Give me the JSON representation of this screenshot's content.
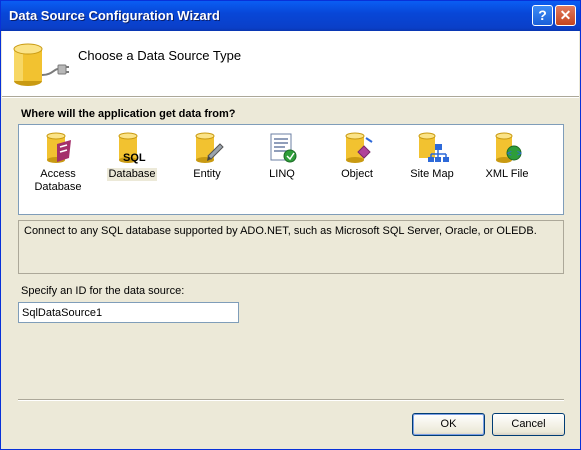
{
  "window": {
    "title": "Data Source Configuration Wizard",
    "help_button": "?",
    "close_button": "✕"
  },
  "header": {
    "title": "Choose a Data Source Type"
  },
  "question": "Where will the application get data from?",
  "data_source_types": [
    {
      "label": "Access\nDatabase",
      "icon": "access-database-icon",
      "selected": false
    },
    {
      "label": "Database",
      "icon": "sql-database-icon",
      "selected": true
    },
    {
      "label": "Entity",
      "icon": "entity-icon",
      "selected": false
    },
    {
      "label": "LINQ",
      "icon": "linq-icon",
      "selected": false
    },
    {
      "label": "Object",
      "icon": "object-icon",
      "selected": false
    },
    {
      "label": "Site Map",
      "icon": "site-map-icon",
      "selected": false
    },
    {
      "label": "XML File",
      "icon": "xml-file-icon",
      "selected": false
    }
  ],
  "description": "Connect to any SQL database supported by ADO.NET, such as Microsoft SQL Server, Oracle, or OLEDB.",
  "id_field": {
    "label": "Specify an ID for the data source:",
    "value": "SqlDataSource1"
  },
  "buttons": {
    "ok": "OK",
    "cancel": "Cancel"
  },
  "colors": {
    "titlebar": "#0a5ef3",
    "dialog_bg": "#ece9d8",
    "cylinder": "#f2c230"
  }
}
